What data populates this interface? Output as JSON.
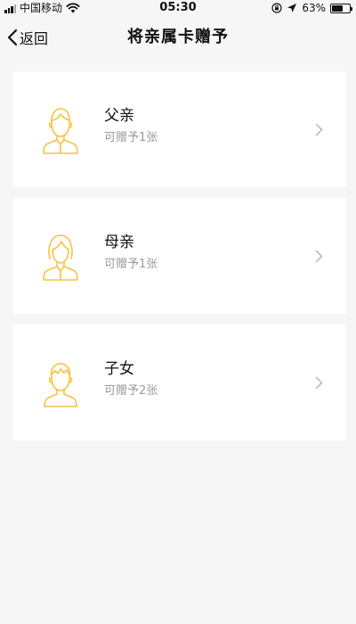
{
  "status_bar": {
    "carrier": "中国移动",
    "time": "05:30",
    "battery_percent": "63%",
    "battery_level": 0.63
  },
  "nav": {
    "back_label": "返回",
    "title": "将亲属卡赠予"
  },
  "cards": [
    {
      "title": "父亲",
      "subtitle": "可赠予1张",
      "icon": "father-avatar-icon"
    },
    {
      "title": "母亲",
      "subtitle": "可赠予1张",
      "icon": "mother-avatar-icon"
    },
    {
      "title": "子女",
      "subtitle": "可赠予2张",
      "icon": "child-avatar-icon"
    }
  ],
  "colors": {
    "background": "#f6f6f6",
    "card": "#ffffff",
    "icon_accent": "#f6c342",
    "subtitle": "#9a9a9a",
    "chevron": "#bdbdbd"
  }
}
